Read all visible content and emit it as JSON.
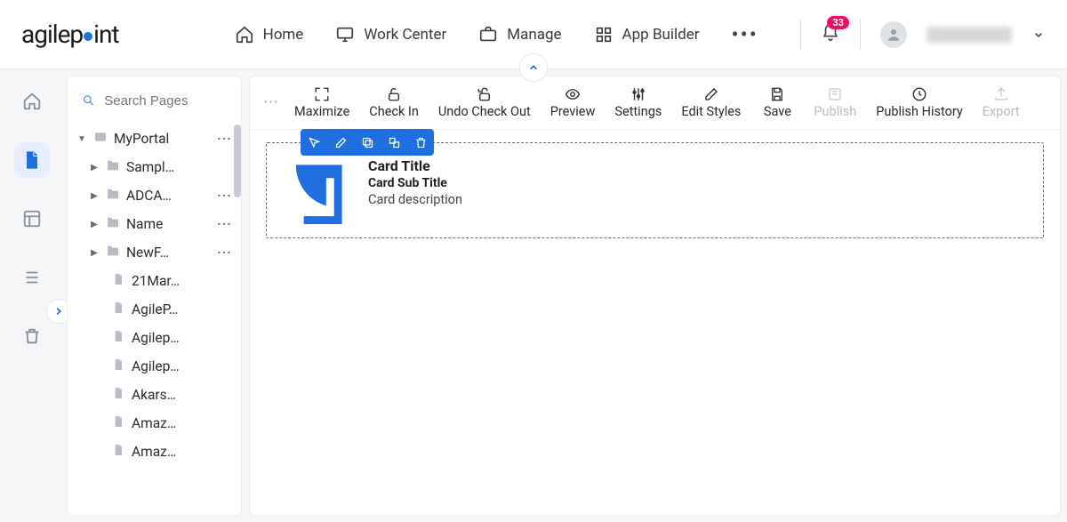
{
  "header": {
    "brand": "agilepoint",
    "nav": [
      {
        "label": "Home"
      },
      {
        "label": "Work Center"
      },
      {
        "label": "Manage"
      },
      {
        "label": "App Builder"
      }
    ],
    "notification_count": "33"
  },
  "rail": {
    "items": [
      "home",
      "pages",
      "templates",
      "list",
      "trash"
    ],
    "active_index": 1
  },
  "sidebar": {
    "search_placeholder": "Search Pages",
    "root": {
      "label": "MyPortal"
    },
    "folders": [
      {
        "label": "Sampl…"
      },
      {
        "label": "ADCA…"
      },
      {
        "label": "Name"
      },
      {
        "label": "NewF…"
      }
    ],
    "pages": [
      {
        "label": "21Mar…"
      },
      {
        "label": "AgileP…"
      },
      {
        "label": "Agilep…"
      },
      {
        "label": "Agilep…"
      },
      {
        "label": "Akars…"
      },
      {
        "label": "Amaz…"
      },
      {
        "label": "Amaz…"
      }
    ]
  },
  "toolbar": {
    "more": "···",
    "buttons": {
      "maximize": "Maximize",
      "checkin": "Check In",
      "undocheckout": "Undo Check Out",
      "preview": "Preview",
      "settings": "Settings",
      "editstyles": "Edit Styles",
      "save": "Save",
      "publish": "Publish",
      "publishhistory": "Publish History",
      "export": "Export"
    }
  },
  "card": {
    "title": "Card Title",
    "subtitle": "Card Sub Title",
    "description": "Card description"
  }
}
